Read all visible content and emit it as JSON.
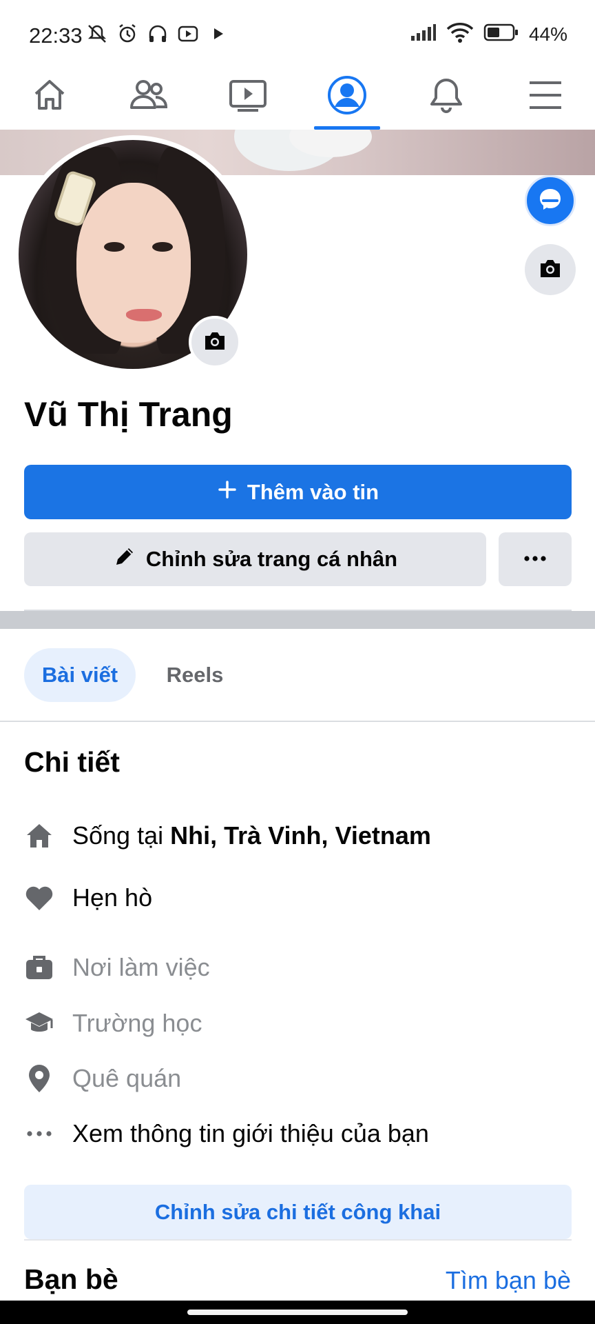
{
  "status_bar": {
    "time": "22:33",
    "battery": "44%"
  },
  "nav": {
    "items": [
      {
        "icon": "home-icon",
        "active": false
      },
      {
        "icon": "friends-icon",
        "active": false
      },
      {
        "icon": "video-icon",
        "active": false
      },
      {
        "icon": "profile-icon",
        "active": true
      },
      {
        "icon": "bell-icon",
        "active": false
      },
      {
        "icon": "menu-icon",
        "active": false
      }
    ],
    "accent": "#1877f2"
  },
  "profile": {
    "name": "Vũ Thị Trang",
    "add_story_label": "Thêm vào tin",
    "edit_profile_label": "Chỉnh sửa trang cá nhân"
  },
  "tabs": [
    {
      "label": "Bài viết",
      "active": true
    },
    {
      "label": "Reels",
      "active": false
    }
  ],
  "details": {
    "title": "Chi tiết",
    "lives_in_prefix": "Sống tại ",
    "lives_in_place": "Nhi, Trà Vinh, Vietnam",
    "relationship": "Hẹn hò",
    "workplace": "Nơi làm việc",
    "school": "Trường học",
    "hometown": "Quê quán",
    "see_about": "Xem thông tin giới thiệu của bạn",
    "edit_public_label": "Chỉnh sửa chi tiết công khai"
  },
  "friends": {
    "title": "Bạn bè",
    "find_label": "Tìm bạn bè"
  }
}
